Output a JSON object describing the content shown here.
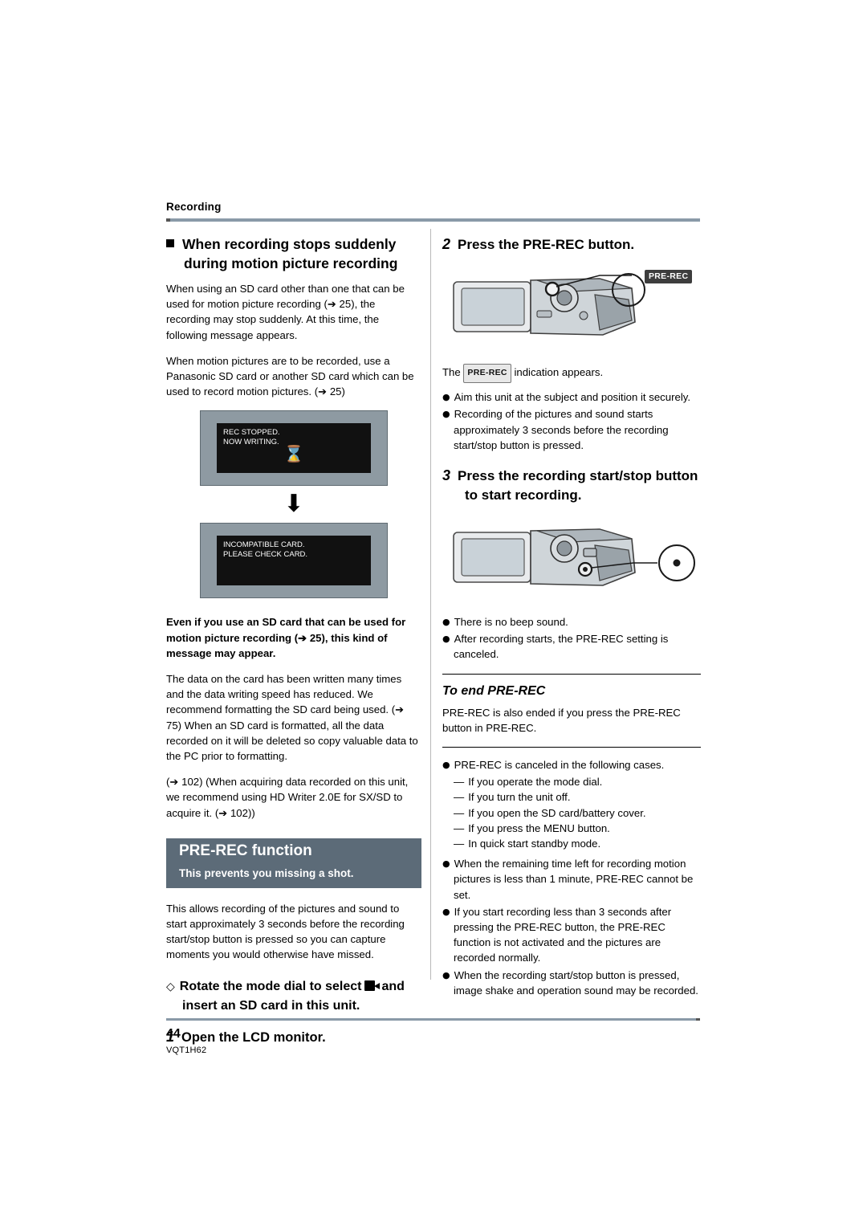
{
  "header": {
    "section": "Recording"
  },
  "left": {
    "heading": "When recording stops suddenly during motion picture recording",
    "para1": "When using an SD card other than one that can be used for motion picture recording (➔ 25), the recording may stop suddenly. At this time, the following message appears.",
    "para2": "When motion pictures are to be recorded, use a Panasonic SD card or another SD card which can be used to record motion pictures. (➔ 25)",
    "msgbox1_line1": "REC STOPPED.",
    "msgbox1_line2": "NOW WRITING.",
    "msgbox1_icon": "hourglass-icon",
    "msgbox2_line1": "INCOMPATIBLE CARD.",
    "msgbox2_line2": "PLEASE CHECK CARD.",
    "bold_note": "Even if you use an SD card that can be used for motion picture recording (➔ 25), this kind of message may appear.",
    "para3": "The data on the card has been written many times and the data writing speed has reduced. We recommend formatting the SD card being used. (➔ 75) When an SD card is formatted, all the data recorded on it will be deleted so copy valuable data to the PC prior to formatting.",
    "para4": "(➔ 102) (When acquiring data recorded on this unit, we recommend using HD Writer 2.0E for SX/SD to acquire it. (➔ 102))",
    "banner_title": "PRE-REC function",
    "banner_sub": "This prevents you missing a shot.",
    "para5": "This allows recording of the pictures and sound to start approximately 3 seconds before the recording start/stop button is pressed so you can capture moments you would otherwise have missed.",
    "diamond_step": "Rotate the mode dial to select",
    "diamond_step_end": "and insert an SD card in this unit.",
    "step1_num": "1",
    "step1_text": "Open the LCD monitor."
  },
  "right": {
    "step2_num": "2",
    "step2_text": "Press the PRE-REC button.",
    "prerec_badge": "PRE-REC",
    "the_word": "The",
    "indication_text": "indication appears.",
    "bullets1": [
      "Aim this unit at the subject and position it securely.",
      "Recording of the pictures and sound starts approximately 3 seconds before the recording start/stop button is pressed."
    ],
    "step3_num": "3",
    "step3_text": "Press the recording start/stop button to start recording.",
    "bullets2": [
      "There is no beep sound.",
      "After recording starts, the PRE-REC setting is canceled."
    ],
    "to_end_title": "To end PRE-REC",
    "to_end_body": "PRE-REC is also ended if you press the PRE-REC button in PRE-REC.",
    "bullet_cancel_intro": "PRE-REC is canceled in the following cases.",
    "cancel_cases": [
      "If you operate the mode dial.",
      "If you turn the unit off.",
      "If you open the SD card/battery cover.",
      "If you press the MENU button.",
      "In quick start standby mode."
    ],
    "bullets3": [
      "When the remaining time left for recording motion pictures is less than 1 minute, PRE-REC cannot be set.",
      "If you start recording less than 3 seconds after pressing the PRE-REC button, the PRE-REC function is not activated and the pictures are recorded normally.",
      "When the recording start/stop button is pressed, image shake and operation sound may be recorded."
    ]
  },
  "footer": {
    "page_number": "44",
    "doc_id": "VQT1H62"
  },
  "colors": {
    "rule": "#8a9aa8",
    "banner_bg": "#5c6b78",
    "lcd_bezel": "#8e9aa2",
    "lcd_screen": "#111111"
  }
}
